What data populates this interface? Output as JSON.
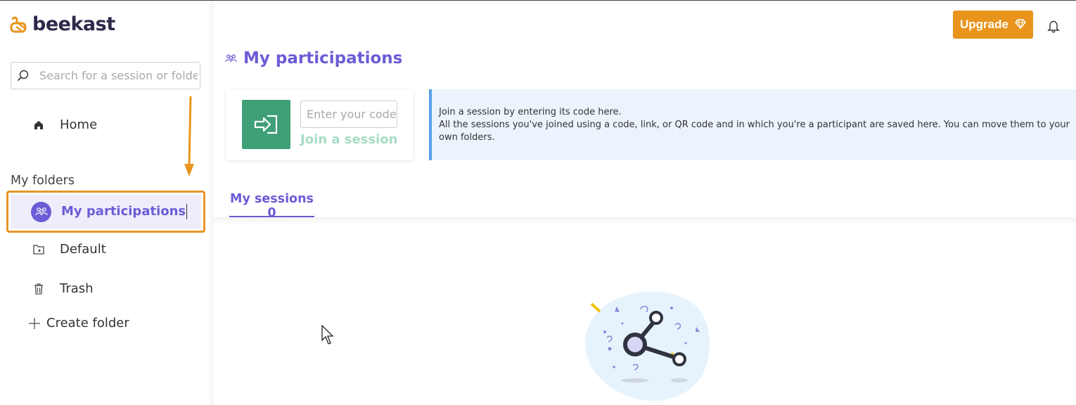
{
  "brand": {
    "name": "beekast",
    "color": "#2c2a4a",
    "logo_accent": "#e8941d"
  },
  "search": {
    "placeholder": "Search for a session or folder"
  },
  "nav": {
    "home_label": "Home",
    "folders_heading": "My folders",
    "active_label": "My participations",
    "default_label": "Default",
    "trash_label": "Trash",
    "create_label": "Create folder"
  },
  "header": {
    "upgrade_label": "Upgrade"
  },
  "page": {
    "title": "My participations"
  },
  "join": {
    "code_placeholder": "Enter your code",
    "join_label": "Join a session"
  },
  "info": {
    "line1": "Join a session by entering its code here.",
    "line2": "All the sessions you've joined using a code, link, or QR code and in which you're a participant are saved here. You can move them to your own folders."
  },
  "tabs": {
    "sessions_label": "My sessions 0"
  },
  "colors": {
    "accent": "#6b5cd6",
    "green": "#3f9f77",
    "orange": "#e8941d",
    "info_bg": "#ebf3fc"
  }
}
